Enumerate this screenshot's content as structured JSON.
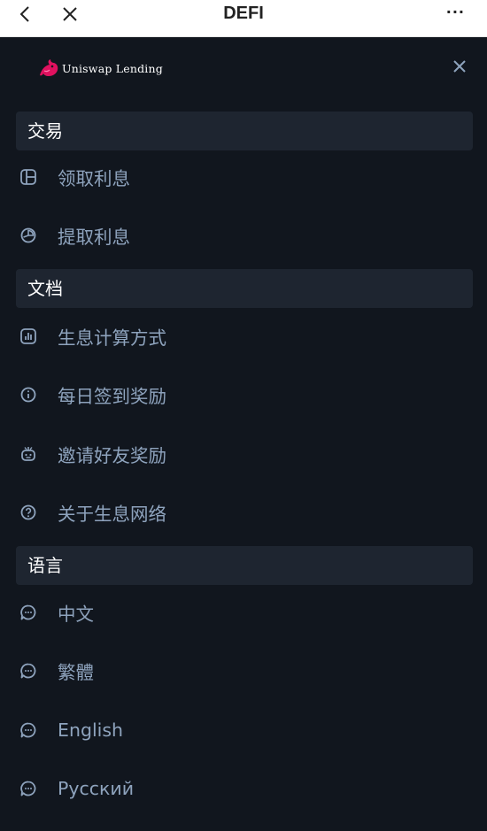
{
  "topbar": {
    "title": "DEFI",
    "more_label": "···"
  },
  "brand": {
    "name": "Uniswap Lending"
  },
  "sections": {
    "trade": {
      "label": "交易"
    },
    "docs": {
      "label": "文档"
    },
    "language": {
      "label": "语言"
    }
  },
  "menu": {
    "claim_interest": {
      "label": "领取利息",
      "icon": "layout-icon"
    },
    "withdraw_interest": {
      "label": "提取利息",
      "icon": "pie-chart-icon"
    },
    "interest_calc": {
      "label": "生息计算方式",
      "icon": "bar-chart-icon"
    },
    "daily_checkin": {
      "label": "每日签到奖励",
      "icon": "info-icon"
    },
    "invite_friends": {
      "label": "邀请好友奖励",
      "icon": "robot-icon"
    },
    "about_network": {
      "label": "关于生息网络",
      "icon": "help-icon"
    },
    "lang_zh": {
      "label": "中文",
      "icon": "chat-icon"
    },
    "lang_zh_tw": {
      "label": "繁體",
      "icon": "chat-icon"
    },
    "lang_en": {
      "label": "English",
      "icon": "chat-icon"
    },
    "lang_ru": {
      "label": "Русский",
      "icon": "chat-icon"
    }
  },
  "colors": {
    "background": "#11161e",
    "section_bg": "#1e2530",
    "item_text": "#8ea3bd",
    "accent_logo": "#e0115f"
  }
}
